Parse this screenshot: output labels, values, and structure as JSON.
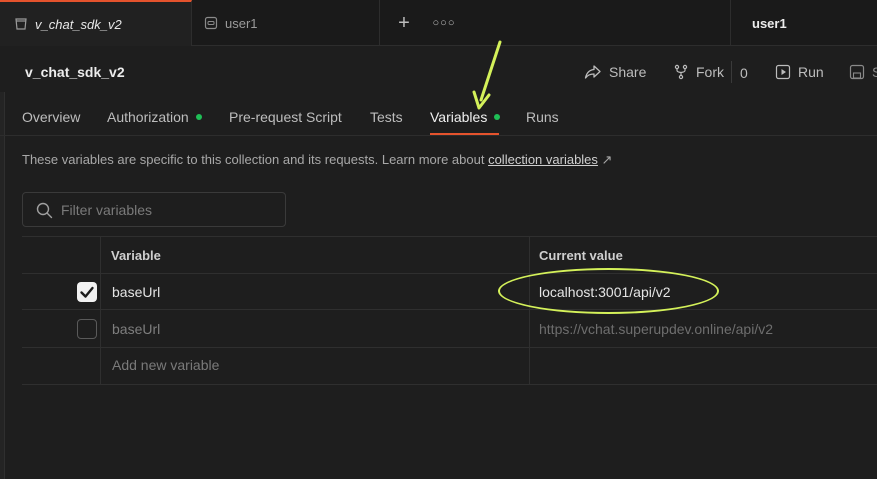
{
  "tabs": {
    "active": "v_chat_sdk_v2",
    "second": "user1",
    "environment": "user1"
  },
  "header": {
    "title": "v_chat_sdk_v2",
    "share_label": "Share",
    "fork_label": "Fork",
    "fork_count": "0",
    "run_label": "Run",
    "save_label": "S"
  },
  "subtabs": [
    {
      "label": "Overview",
      "dot": false
    },
    {
      "label": "Authorization",
      "dot": true
    },
    {
      "label": "Pre-request Script",
      "dot": false
    },
    {
      "label": "Tests",
      "dot": false
    },
    {
      "label": "Variables",
      "dot": true,
      "active": true
    },
    {
      "label": "Runs",
      "dot": false
    }
  ],
  "description": {
    "text": "These variables are specific to this collection and its requests. Learn more about ",
    "link": "collection variables",
    "link_arrow": "↗"
  },
  "filter": {
    "placeholder": "Filter variables"
  },
  "table": {
    "headers": {
      "variable": "Variable",
      "current_value": "Current value"
    },
    "rows": [
      {
        "checked": true,
        "variable": "baseUrl",
        "current_value": "localhost:3001/api/v2"
      },
      {
        "checked": false,
        "variable": "baseUrl",
        "current_value": "https://vchat.superupdev.online/api/v2"
      }
    ],
    "add_placeholder": "Add new variable"
  },
  "colors": {
    "accent": "#e5532d",
    "status_dot": "#1fbf56",
    "annotation": "#d4f15a"
  }
}
